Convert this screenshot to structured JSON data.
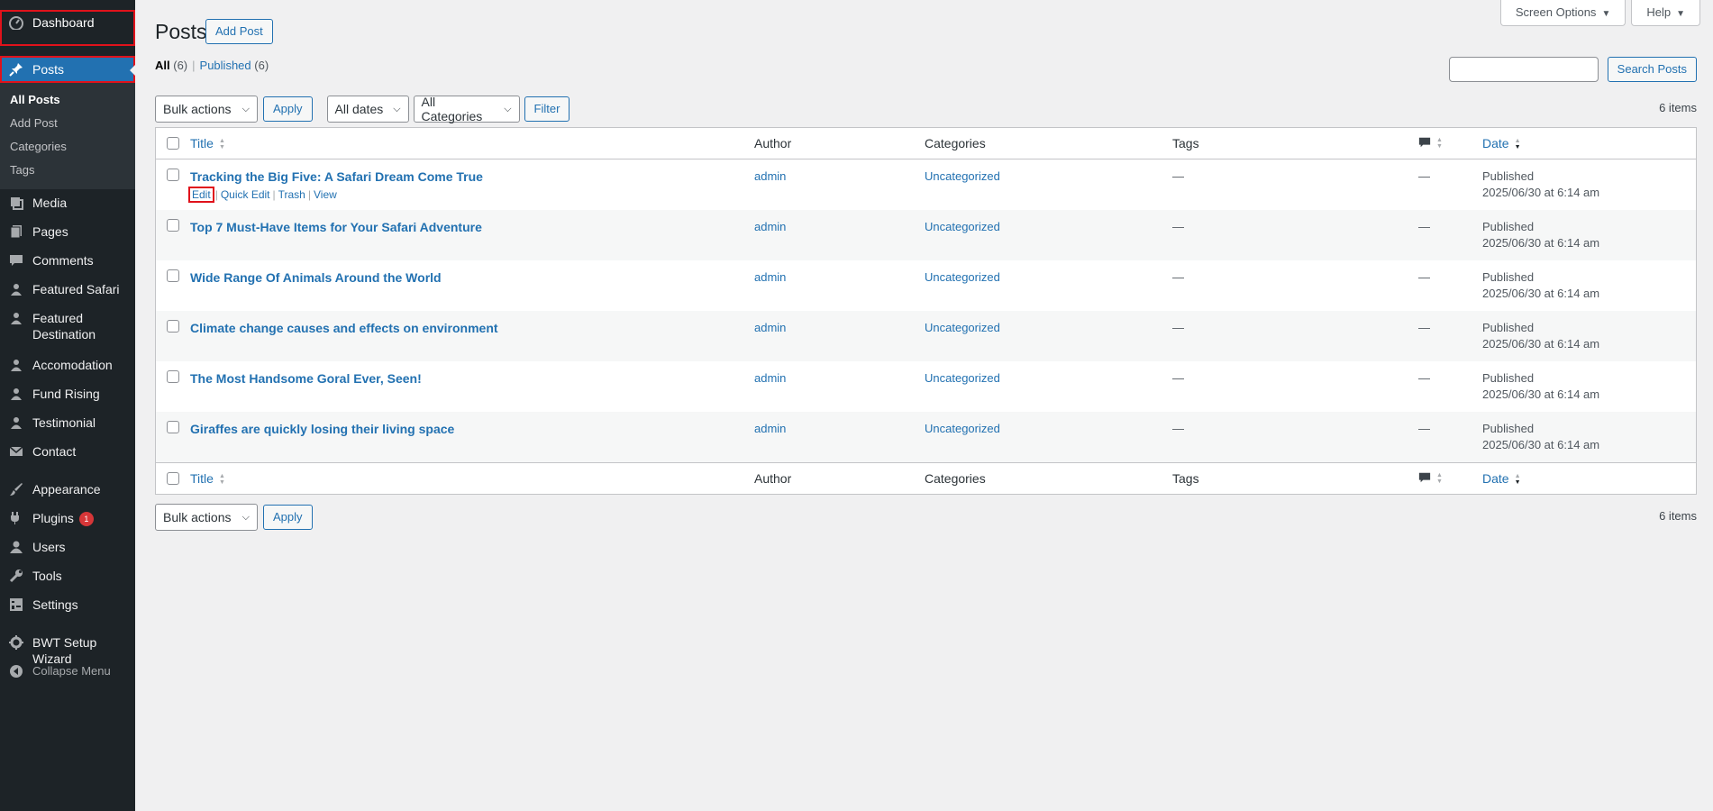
{
  "sidebar": {
    "dashboard": "Dashboard",
    "posts": "Posts",
    "posts_submenu": [
      "All Posts",
      "Add Post",
      "Categories",
      "Tags"
    ],
    "items": [
      {
        "label": "Media",
        "icon": "media-icon"
      },
      {
        "label": "Pages",
        "icon": "pages-icon"
      },
      {
        "label": "Comments",
        "icon": "comments-icon"
      },
      {
        "label": "Featured Safari",
        "icon": "users-group-icon"
      },
      {
        "label": "Featured Destination",
        "icon": "users-group-icon"
      },
      {
        "label": "Accomodation",
        "icon": "users-group-icon"
      },
      {
        "label": "Fund Rising",
        "icon": "users-group-icon"
      },
      {
        "label": "Testimonial",
        "icon": "users-group-icon"
      },
      {
        "label": "Contact",
        "icon": "mail-icon"
      }
    ],
    "items2": [
      {
        "label": "Appearance",
        "icon": "brush-icon"
      },
      {
        "label": "Plugins",
        "icon": "plugin-icon",
        "badge": "1"
      },
      {
        "label": "Users",
        "icon": "user-icon"
      },
      {
        "label": "Tools",
        "icon": "wrench-icon"
      },
      {
        "label": "Settings",
        "icon": "settings-icon"
      }
    ],
    "bwt": "BWT Setup Wizard",
    "collapse": "Collapse Menu"
  },
  "header": {
    "screen_options": "Screen Options",
    "help": "Help",
    "title": "Posts",
    "add_post": "Add Post"
  },
  "views": {
    "all_label": "All",
    "all_count": "(6)",
    "published_label": "Published",
    "published_count": "(6)"
  },
  "search": {
    "button": "Search Posts",
    "value": ""
  },
  "filters": {
    "bulk_actions": "Bulk actions",
    "apply": "Apply",
    "dates": "All dates",
    "categories": "All Categories",
    "filter": "Filter",
    "items_count": "6 items"
  },
  "table": {
    "columns": {
      "title": "Title",
      "author": "Author",
      "categories": "Categories",
      "tags": "Tags",
      "date": "Date"
    },
    "row_actions": {
      "edit": "Edit",
      "quick_edit": "Quick Edit",
      "trash": "Trash",
      "view": "View"
    },
    "rows": [
      {
        "title": "Tracking the Big Five: A Safari Dream Come True",
        "author": "admin",
        "category": "Uncategorized",
        "tags": "—",
        "comments": "—",
        "status": "Published",
        "date": "2025/06/30 at 6:14 am"
      },
      {
        "title": "Top 7 Must-Have Items for Your Safari Adventure",
        "author": "admin",
        "category": "Uncategorized",
        "tags": "—",
        "comments": "—",
        "status": "Published",
        "date": "2025/06/30 at 6:14 am"
      },
      {
        "title": "Wide Range Of Animals Around the World",
        "author": "admin",
        "category": "Uncategorized",
        "tags": "—",
        "comments": "—",
        "status": "Published",
        "date": "2025/06/30 at 6:14 am"
      },
      {
        "title": "Climate change causes and effects on environment",
        "author": "admin",
        "category": "Uncategorized",
        "tags": "—",
        "comments": "—",
        "status": "Published",
        "date": "2025/06/30 at 6:14 am"
      },
      {
        "title": "The Most Handsome Goral Ever, Seen!",
        "author": "admin",
        "category": "Uncategorized",
        "tags": "—",
        "comments": "—",
        "status": "Published",
        "date": "2025/06/30 at 6:14 am"
      },
      {
        "title": "Giraffes are quickly losing their living space",
        "author": "admin",
        "category": "Uncategorized",
        "tags": "—",
        "comments": "—",
        "status": "Published",
        "date": "2025/06/30 at 6:14 am"
      }
    ]
  },
  "colors": {
    "accent": "#2271b1",
    "sidebar_bg": "#1d2327",
    "highlight": "#e0121b",
    "trash": "#b32d2e"
  }
}
